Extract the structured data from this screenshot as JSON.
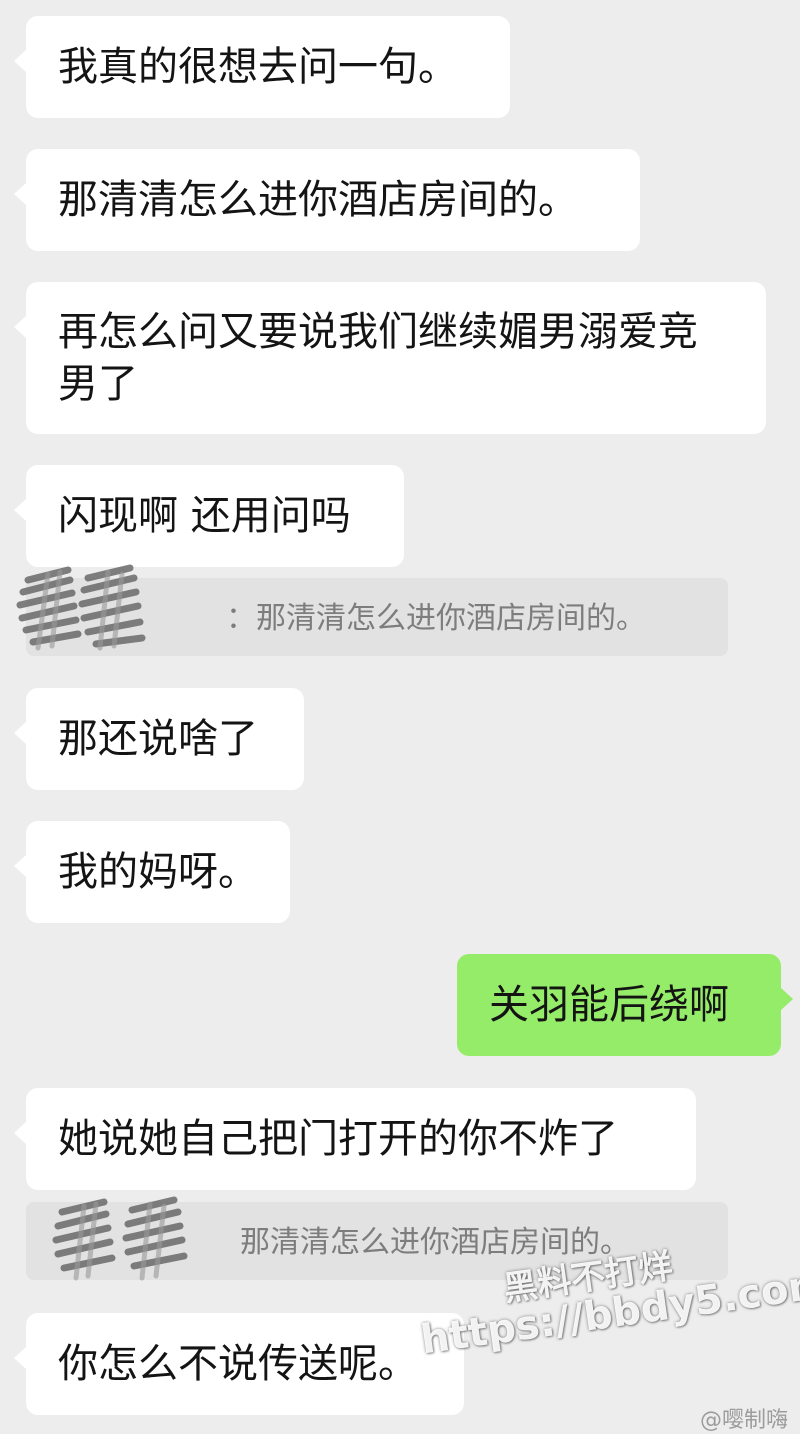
{
  "messages": [
    {
      "side": "left",
      "text": "我真的很想去问一句。"
    },
    {
      "side": "left",
      "text": "那清清怎么进你酒店房间的。"
    },
    {
      "side": "left",
      "text": "再怎么问又要说我们继续媚男溺爱竞男了"
    },
    {
      "side": "left",
      "text": "闪现啊 还用问吗"
    },
    {
      "side": "left",
      "text": "那还说啥了"
    },
    {
      "side": "left",
      "text": "我的妈呀。"
    },
    {
      "side": "right",
      "text": "关羽能后绕啊"
    },
    {
      "side": "left",
      "text": "她说她自己把门打开的你不炸了"
    },
    {
      "side": "left",
      "text": "你怎么不说传送呢。"
    }
  ],
  "quotes": [
    {
      "text": "：那清清怎么进你酒店房间的。"
    },
    {
      "text": "那清清怎么进你酒店房间的。"
    }
  ],
  "watermark": {
    "line1": "黑料不打烊",
    "line2": "https://bbdy5.com"
  },
  "credit": "@嘤制嗨",
  "colors": {
    "background": "#ededed",
    "incoming_bubble": "#ffffff",
    "outgoing_bubble": "#95ec69",
    "quote_background": "#e2e2e2",
    "quote_text": "#7d7d7d"
  }
}
